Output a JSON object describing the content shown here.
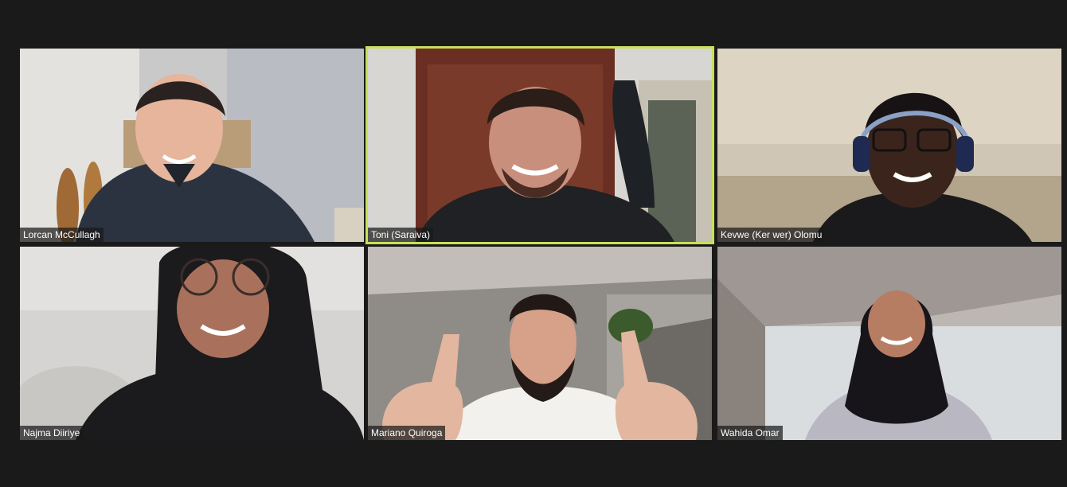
{
  "meeting": {
    "view": "Gallery View",
    "active_speaker_border_color": "#c7e05a",
    "background_color": "#1a1a1a",
    "participants": [
      {
        "name": "Lorcan McCullagh",
        "video_on": true,
        "active_speaker": false
      },
      {
        "name": "Toni (Saraiva)",
        "video_on": true,
        "active_speaker": true
      },
      {
        "name": "Kevwe (Ker wer) Olomu",
        "video_on": true,
        "active_speaker": false
      },
      {
        "name": "Najma Diiriye",
        "video_on": true,
        "active_speaker": false
      },
      {
        "name": "Mariano Quiroga",
        "video_on": true,
        "active_speaker": false
      },
      {
        "name": "Wahida Omar",
        "video_on": true,
        "active_speaker": false
      }
    ]
  }
}
